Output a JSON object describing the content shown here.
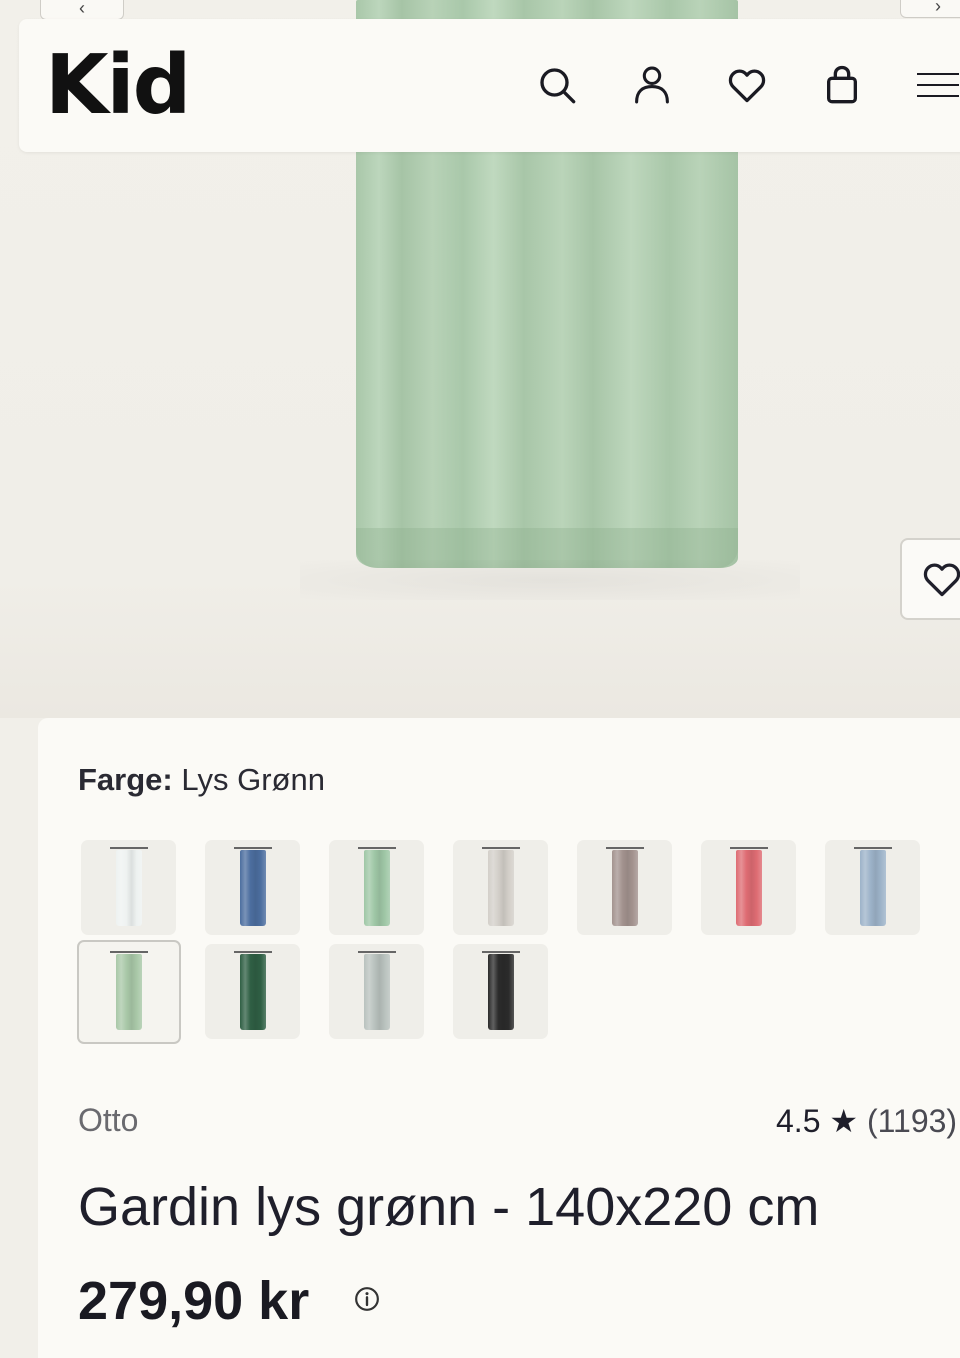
{
  "header": {
    "logo": "Kid",
    "icons": [
      "search-icon",
      "user-icon",
      "heart-icon",
      "bag-icon",
      "menu-icon"
    ]
  },
  "gallery": {
    "prev_icon": "‹",
    "next_icon": "›",
    "favorite_icon": "heart-icon"
  },
  "product": {
    "color_label": "Farge:",
    "color_value": "Lys Grønn",
    "swatches": [
      {
        "name": "Hvit",
        "color": "#eef2f1"
      },
      {
        "name": "Blå",
        "color": "#4c6e9f"
      },
      {
        "name": "Grønn",
        "color": "#9fc7a6"
      },
      {
        "name": "Beige",
        "color": "#d3cfc9"
      },
      {
        "name": "Brun",
        "color": "#a3938f"
      },
      {
        "name": "Rosa",
        "color": "#de6c73"
      },
      {
        "name": "Lys Blå",
        "color": "#9db3c9"
      },
      {
        "name": "Lys Grønn",
        "color": "#a9c8a8"
      },
      {
        "name": "Mørk Grønn",
        "color": "#2f5f44"
      },
      {
        "name": "Grå",
        "color": "#b9c2be"
      },
      {
        "name": "Svart",
        "color": "#2b2b2b"
      }
    ],
    "selected_index": 7,
    "brand": "Otto",
    "rating": "4.5",
    "rating_star": "★",
    "review_count": "(1193)",
    "title": "Gardin lys grønn - 140x220 cm",
    "price": "279,90 kr"
  }
}
